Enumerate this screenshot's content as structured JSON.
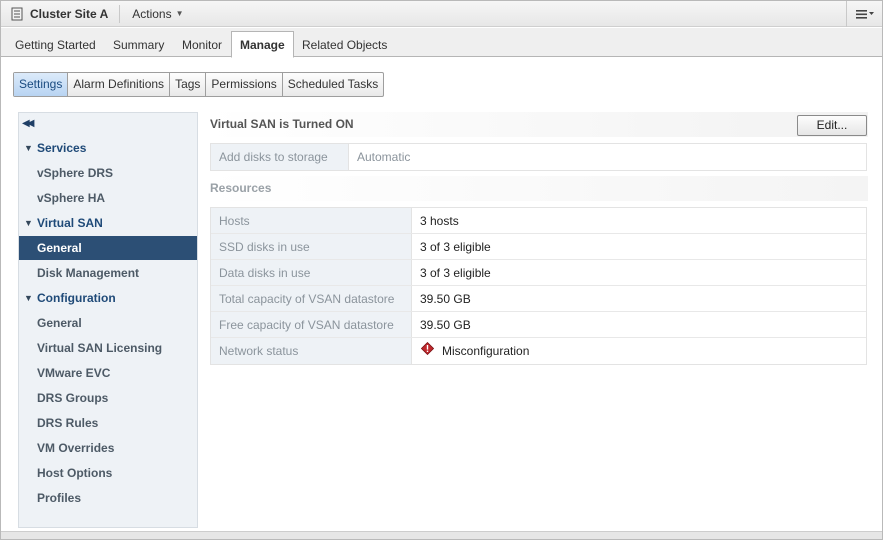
{
  "window": {
    "title": "Cluster Site A",
    "actions_label": "Actions",
    "icons": {
      "cluster": "cluster-icon",
      "menu": "menu-icon"
    }
  },
  "tabs": [
    {
      "label": "Getting Started"
    },
    {
      "label": "Summary"
    },
    {
      "label": "Monitor"
    },
    {
      "label": "Manage",
      "active": true
    },
    {
      "label": "Related Objects"
    }
  ],
  "subtabs": [
    {
      "label": "Settings",
      "active": true
    },
    {
      "label": "Alarm Definitions"
    },
    {
      "label": "Tags"
    },
    {
      "label": "Permissions"
    },
    {
      "label": "Scheduled Tasks"
    }
  ],
  "sidebar": {
    "groups": [
      {
        "label": "Services",
        "items": [
          {
            "label": "vSphere DRS"
          },
          {
            "label": "vSphere HA"
          }
        ]
      },
      {
        "label": "Virtual SAN",
        "items": [
          {
            "label": "General",
            "selected": true
          },
          {
            "label": "Disk Management"
          }
        ]
      },
      {
        "label": "Configuration",
        "items": [
          {
            "label": "General"
          },
          {
            "label": "Virtual SAN Licensing"
          },
          {
            "label": "VMware EVC"
          },
          {
            "label": "DRS Groups"
          },
          {
            "label": "DRS Rules"
          },
          {
            "label": "VM Overrides"
          },
          {
            "label": "Host Options"
          },
          {
            "label": "Profiles"
          }
        ]
      }
    ]
  },
  "main": {
    "vsan_status": "Virtual SAN is Turned ON",
    "edit_label": "Edit...",
    "settings": [
      {
        "key": "Add disks to storage",
        "value": "Automatic"
      }
    ],
    "resources_title": "Resources",
    "resources": [
      {
        "key": "Hosts",
        "value": "3 hosts"
      },
      {
        "key": "SSD disks in use",
        "value": "3 of 3 eligible"
      },
      {
        "key": "Data disks in use",
        "value": "3 of 3 eligible"
      },
      {
        "key": "Total capacity of VSAN datastore",
        "value": "39.50 GB"
      },
      {
        "key": "Free capacity of VSAN datastore",
        "value": "39.50 GB"
      },
      {
        "key": "Network status",
        "value": "Misconfiguration",
        "icon": "error-icon"
      }
    ]
  },
  "colors": {
    "selected_nav": "#2c4f75",
    "nav_group": "#1f4a78",
    "active_subtab": "#b8d4f2",
    "error": "#c0282d"
  }
}
